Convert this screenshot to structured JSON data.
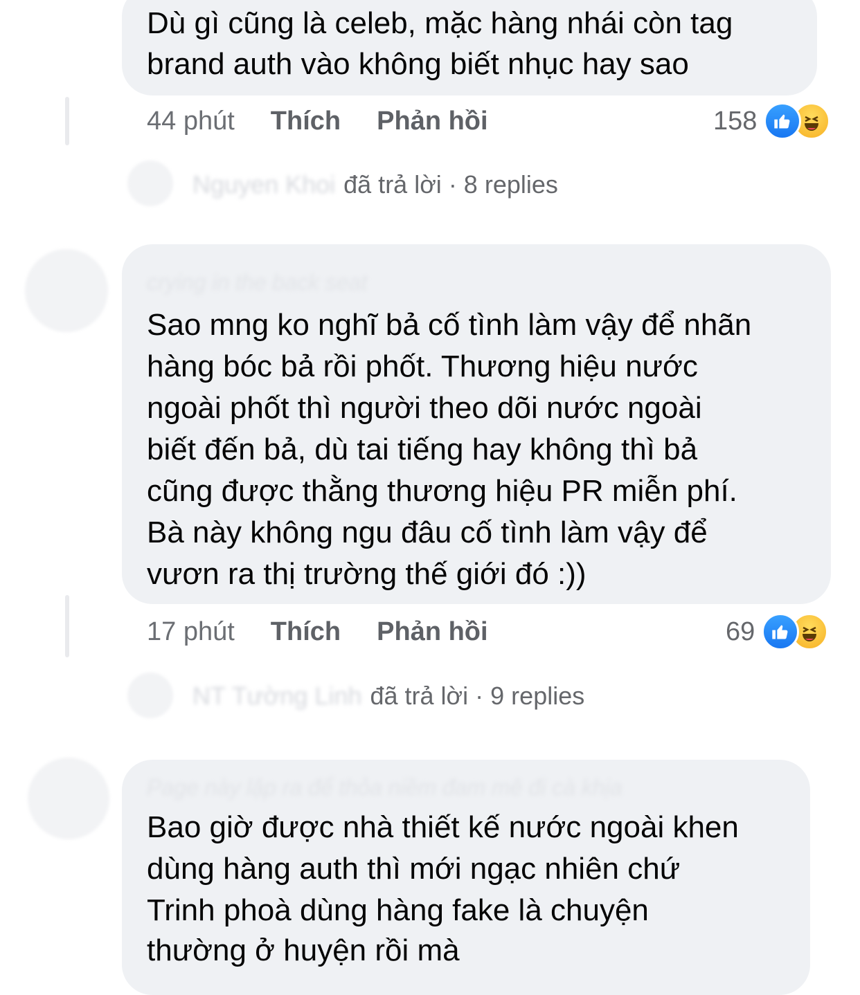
{
  "comments": [
    {
      "text_lines": [
        "Dù gì cũng là celeb, mặc hàng nhái còn tag",
        "brand auth vào không biết nhục hay sao"
      ],
      "time": "44 phút",
      "like_label": "Thích",
      "reply_label": "Phản hồi",
      "reaction_count": "158",
      "replies": {
        "name": "Nguyen Khoi",
        "action": "đã trả lời",
        "count": "· 8 replies"
      }
    },
    {
      "author": "crying in the back seat",
      "text_lines": [
        "Sao mng ko nghĩ bả cố tình làm vậy để nhãn",
        "hàng bóc bả rồi phốt. Thương hiệu nước",
        "ngoài phốt thì người theo dõi nước ngoài",
        "biết đến bả, dù tai tiếng hay không thì bả",
        "cũng được thằng thương hiệu PR miễn phí.",
        "Bà này không ngu đâu cố tình làm vậy để",
        "vươn ra thị trường thế giới đó :))"
      ],
      "time": "17 phút",
      "like_label": "Thích",
      "reply_label": "Phản hồi",
      "reaction_count": "69",
      "replies": {
        "name": "NT Tường Linh",
        "action": "đã trả lời",
        "count": "· 9 replies"
      }
    },
    {
      "author": "Page này lập ra để thỏa niềm đam mê đi cà khịa",
      "text_lines": [
        "Bao giờ được nhà thiết kế nước ngoài khen",
        "dùng hàng auth thì mới ngạc nhiên chứ",
        "Trinh phoà dùng hàng fake là chuyện",
        "thường ở huyện rồi mà"
      ]
    }
  ],
  "colors": {
    "bubble": "#eff1f4",
    "meta": "#65676b",
    "like": "#1877f2",
    "haha": "#f7b125"
  },
  "icons": {
    "like": "like-reaction-icon",
    "haha": "haha-reaction-icon"
  }
}
